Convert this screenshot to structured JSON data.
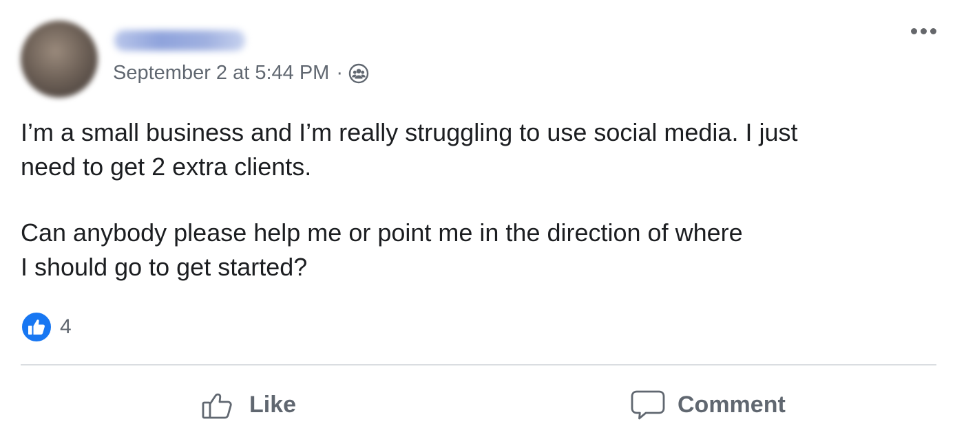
{
  "post": {
    "timestamp": "September 2 at 5:44 PM",
    "separator": "·",
    "audience_icon": "group-audience-icon",
    "body_paragraphs": [
      "I’m a small business and I’m really struggling to use social media. I just\nneed to get 2 extra clients.",
      "Can anybody please help me or point me in the direction of where\nI should go to get started?"
    ],
    "reactions": {
      "icon": "like-reaction-icon",
      "count": "4",
      "color": "#1877f2"
    }
  },
  "actions": {
    "like_label": "Like",
    "comment_label": "Comment"
  },
  "colors": {
    "meta_text": "#606770",
    "body_text": "#1c1e21",
    "divider": "#dadde1",
    "like_blue": "#1877f2"
  }
}
